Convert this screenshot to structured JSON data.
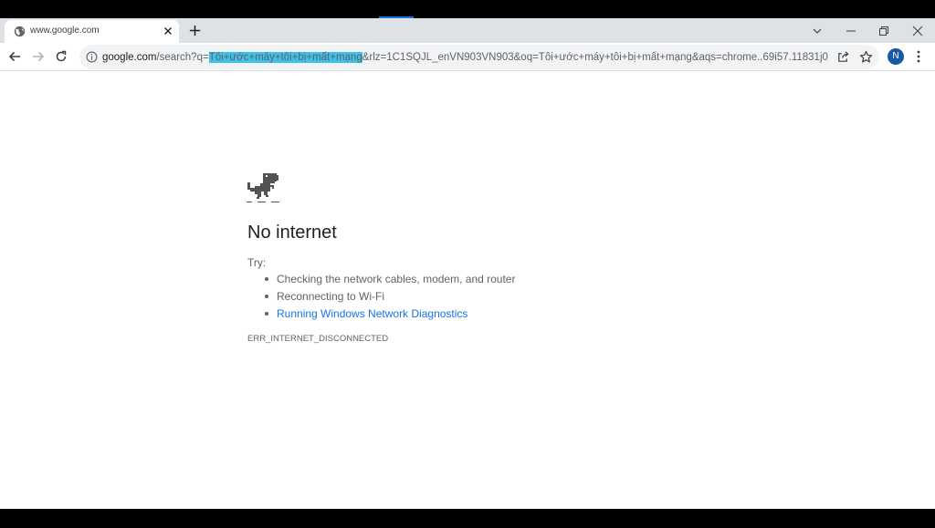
{
  "tab": {
    "title": "www.google.com",
    "favicon": "globe-icon"
  },
  "window_controls": [
    "tab-search-icon",
    "minimize-icon",
    "restore-icon",
    "close-icon"
  ],
  "toolbar": {
    "url": {
      "host": "google.com",
      "path_prefix": "/search?q=",
      "highlighted_query": "Tôi+ước+máy+tôi+bị+mất+mạng",
      "rest": "&rlz=1C1SQJL_enVN903VN903&oq=Tôi+ước+máy+tôi+bị+mất+mạng&aqs=chrome..69i57.11831j0j..."
    },
    "avatar_letter": "N"
  },
  "error_page": {
    "heading": "No internet",
    "try_label": "Try:",
    "suggestions": [
      "Checking the network cables, modem, and router",
      "Reconnecting to Wi-Fi",
      "Running Windows Network Diagnostics"
    ],
    "error_code": "ERR_INTERNET_DISCONNECTED"
  },
  "colors": {
    "link": "#1a73e8",
    "url_highlight": "#3ec1ea",
    "avatar": "#1a5aa5",
    "tabstrip": "#dee1e6"
  }
}
